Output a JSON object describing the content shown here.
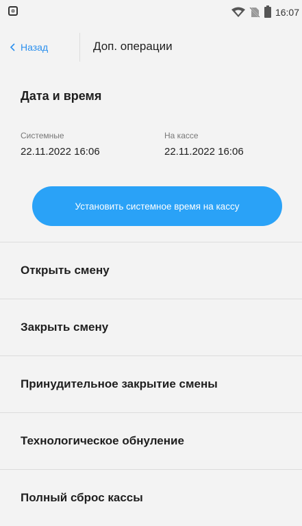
{
  "status_bar": {
    "time": "16:07",
    "icons": [
      "app-icon",
      "wifi-icon",
      "no-sim-icon",
      "battery-icon"
    ]
  },
  "nav": {
    "back_label": "Назад",
    "title": "Доп. операции"
  },
  "datetime": {
    "title": "Дата и время",
    "system_label": "Системные",
    "system_value": "22.11.2022 16:06",
    "kassa_label": "На кассе",
    "kassa_value": "22.11.2022 16:06",
    "button_label": "Установить системное время на кассу"
  },
  "menu": {
    "items": [
      {
        "label": "Открыть смену"
      },
      {
        "label": "Закрыть смену"
      },
      {
        "label": "Принудительное закрытие смены"
      },
      {
        "label": "Технологическое обнуление"
      },
      {
        "label": "Полный сброс кассы"
      }
    ]
  },
  "colors": {
    "accent": "#2a8fee",
    "button": "#2aa2f7",
    "background": "#f3f3f3"
  }
}
